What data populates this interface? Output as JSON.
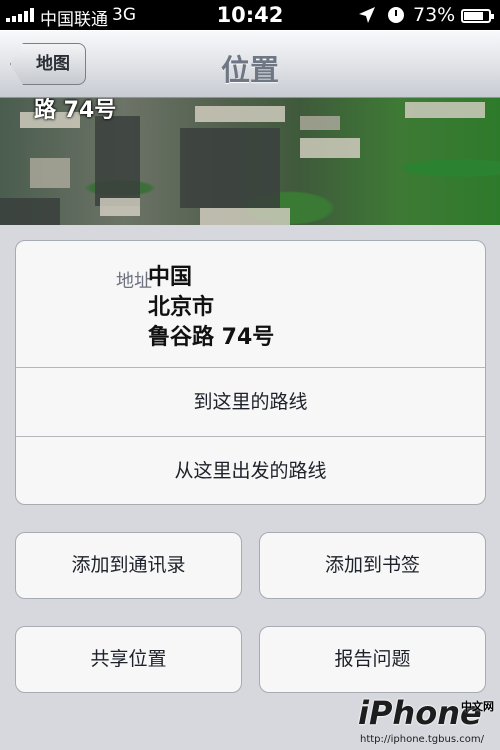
{
  "status_bar": {
    "carrier": "中国联通",
    "network": "3G",
    "time": "10:42",
    "battery_percent": "73%",
    "battery_level": 0.73,
    "icons": [
      "signal-icon",
      "location-arrow-icon",
      "alarm-icon",
      "battery-icon"
    ]
  },
  "nav": {
    "title": "位置",
    "back_label": "地图"
  },
  "map": {
    "partial_label": "路 74号"
  },
  "address": {
    "label": "地址",
    "lines": [
      "中国",
      "北京市",
      "鲁谷路 74号"
    ]
  },
  "routes": {
    "to_here": "到这里的路线",
    "from_here": "从这里出发的路线"
  },
  "actions": {
    "add_contact": "添加到通讯录",
    "add_bookmark": "添加到书签",
    "share_location": "共享位置",
    "report_problem": "报告问题"
  },
  "watermark": {
    "logo": "iPhone",
    "cn": "中文网",
    "url": "http://iphone.tgbus.com/"
  }
}
